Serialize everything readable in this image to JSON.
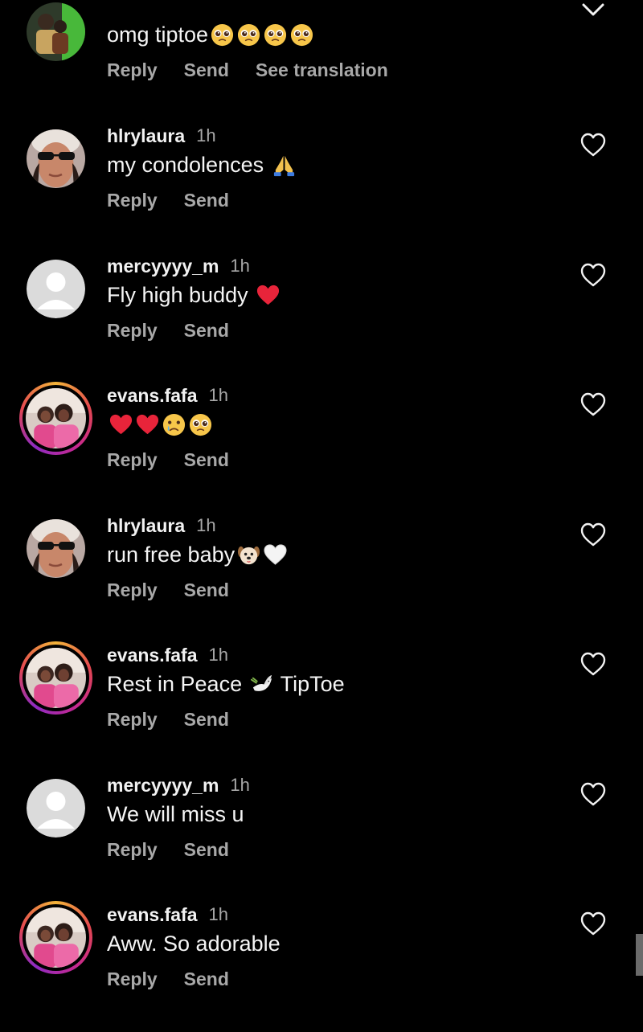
{
  "comments": [
    {
      "username": "",
      "time": "",
      "text": "omg tiptoe",
      "emojis": [
        "pleading-face",
        "pleading-face",
        "pleading-face",
        "pleading-face"
      ],
      "actions": [
        "Reply",
        "Send",
        "See translation"
      ],
      "avatar": "photo-green"
    },
    {
      "username": "hlrylaura",
      "time": "1h",
      "text": "my condolences ",
      "emojis": [
        "folded-hands"
      ],
      "actions": [
        "Reply",
        "Send"
      ],
      "avatar": "photo-girl"
    },
    {
      "username": "mercyyyy_m",
      "time": "1h",
      "text": "Fly high buddy ",
      "emojis": [
        "red-heart"
      ],
      "actions": [
        "Reply",
        "Send"
      ],
      "avatar": "default"
    },
    {
      "username": "evans.fafa",
      "time": "1h",
      "text": "",
      "emojis": [
        "red-heart",
        "red-heart",
        "crying-face",
        "pleading-face"
      ],
      "actions": [
        "Reply",
        "Send"
      ],
      "avatar": "story"
    },
    {
      "username": "hlrylaura",
      "time": "1h",
      "text": "run free baby",
      "emojis": [
        "dog-face",
        "white-heart"
      ],
      "actions": [
        "Reply",
        "Send"
      ],
      "avatar": "photo-girl"
    },
    {
      "username": "evans.fafa",
      "time": "1h",
      "text": "Rest in Peace ",
      "emojis": [
        "dove"
      ],
      "text_after": " TipToe",
      "actions": [
        "Reply",
        "Send"
      ],
      "avatar": "story"
    },
    {
      "username": "mercyyyy_m",
      "time": "1h",
      "text": "We will miss u",
      "emojis": [],
      "actions": [
        "Reply",
        "Send"
      ],
      "avatar": "default"
    },
    {
      "username": "evans.fafa",
      "time": "1h",
      "text": "Aww. So adorable",
      "emojis": [],
      "actions": [
        "Reply",
        "Send"
      ],
      "avatar": "story"
    }
  ],
  "icons": {
    "like": "heart-outline-icon",
    "collapse": "chevron-down-icon"
  },
  "colors": {
    "background": "#000000",
    "primary_text": "#f5f5f5",
    "secondary_text": "#a8a8a8",
    "heart_red": "#e8243a",
    "emoji_yellow": "#f7c64a"
  }
}
